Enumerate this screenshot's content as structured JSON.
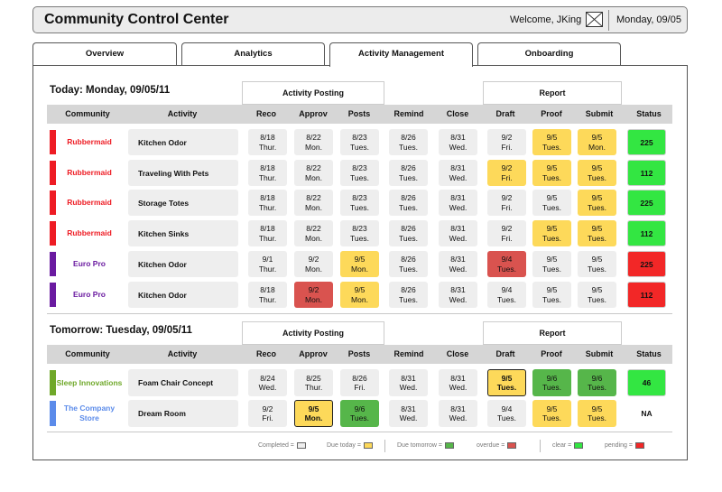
{
  "header": {
    "title": "Community Control Center",
    "welcome": "Welcome, JKing",
    "date": "Monday, 09/05"
  },
  "tabs": [
    "Overview",
    "Analytics",
    "Activity Management",
    "Onboarding"
  ],
  "active_tab": "Activity Management",
  "colors": {
    "completed": "#eeeeee",
    "due_today": "#fdd95a",
    "due_tomorrow": "#56b64a",
    "overdue": "#d9534f",
    "clear": "#33e642",
    "pending": "#f22727",
    "rubbermaid": "#ee1c24",
    "europro": "#6a1aa0",
    "sleep_innovations": "#6fa829",
    "company_store": "#5b8bea"
  },
  "group_labels": {
    "posting": "Activity Posting",
    "report": "Report"
  },
  "columns": [
    "Community",
    "Activity",
    "Reco",
    "Approv",
    "Posts",
    "Remind",
    "Close",
    "Draft",
    "Proof",
    "Submit",
    "Status"
  ],
  "sections": [
    {
      "title": "Today: Monday, 09/05/11",
      "rows": [
        {
          "community": "Rubbermaid",
          "community_color": "#ee1c24",
          "activity": "Kitchen Odor",
          "cells": [
            [
              "8/18",
              "Thur.",
              "c"
            ],
            [
              "8/22",
              "Mon.",
              "c"
            ],
            [
              "8/23",
              "Tues.",
              "c"
            ],
            [
              "8/26",
              "Tues.",
              "c"
            ],
            [
              "8/31",
              "Wed.",
              "c"
            ],
            [
              "9/2",
              "Fri.",
              "c"
            ],
            [
              "9/5",
              "Tues.",
              "y"
            ],
            [
              "9/5",
              "Mon.",
              "y"
            ]
          ],
          "status": "225",
          "status_color": "g"
        },
        {
          "community": "Rubbermaid",
          "community_color": "#ee1c24",
          "activity": "Traveling With Pets",
          "cells": [
            [
              "8/18",
              "Thur.",
              "c"
            ],
            [
              "8/22",
              "Mon.",
              "c"
            ],
            [
              "8/23",
              "Tues.",
              "c"
            ],
            [
              "8/26",
              "Tues.",
              "c"
            ],
            [
              "8/31",
              "Wed.",
              "c"
            ],
            [
              "9/2",
              "Fri.",
              "y"
            ],
            [
              "9/5",
              "Tues.",
              "y"
            ],
            [
              "9/5",
              "Tues.",
              "y"
            ]
          ],
          "status": "112",
          "status_color": "g"
        },
        {
          "community": "Rubbermaid",
          "community_color": "#ee1c24",
          "activity": "Storage Totes",
          "cells": [
            [
              "8/18",
              "Thur.",
              "c"
            ],
            [
              "8/22",
              "Mon.",
              "c"
            ],
            [
              "8/23",
              "Tues.",
              "c"
            ],
            [
              "8/26",
              "Tues.",
              "c"
            ],
            [
              "8/31",
              "Wed.",
              "c"
            ],
            [
              "9/2",
              "Fri.",
              "c"
            ],
            [
              "9/5",
              "Tues.",
              "c"
            ],
            [
              "9/5",
              "Tues.",
              "y"
            ]
          ],
          "status": "225",
          "status_color": "g"
        },
        {
          "community": "Rubbermaid",
          "community_color": "#ee1c24",
          "activity": "Kitchen Sinks",
          "cells": [
            [
              "8/18",
              "Thur.",
              "c"
            ],
            [
              "8/22",
              "Mon.",
              "c"
            ],
            [
              "8/23",
              "Tues.",
              "c"
            ],
            [
              "8/26",
              "Tues.",
              "c"
            ],
            [
              "8/31",
              "Wed.",
              "c"
            ],
            [
              "9/2",
              "Fri.",
              "c"
            ],
            [
              "9/5",
              "Tues.",
              "y"
            ],
            [
              "9/5",
              "Tues.",
              "y"
            ]
          ],
          "status": "112",
          "status_color": "g"
        },
        {
          "community": "Euro Pro",
          "community_color": "#6a1aa0",
          "activity": "Kitchen Odor",
          "cells": [
            [
              "9/1",
              "Thur.",
              "c"
            ],
            [
              "9/2",
              "Mon.",
              "c"
            ],
            [
              "9/5",
              "Mon.",
              "y"
            ],
            [
              "8/26",
              "Tues.",
              "c"
            ],
            [
              "8/31",
              "Wed.",
              "c"
            ],
            [
              "9/4",
              "Tues.",
              "r"
            ],
            [
              "9/5",
              "Tues.",
              "c"
            ],
            [
              "9/5",
              "Tues.",
              "c"
            ]
          ],
          "status": "225",
          "status_color": "r"
        },
        {
          "community": "Euro Pro",
          "community_color": "#6a1aa0",
          "activity": "Kitchen Odor",
          "cells": [
            [
              "8/18",
              "Thur.",
              "c"
            ],
            [
              "9/2",
              "Mon.",
              "r"
            ],
            [
              "9/5",
              "Mon.",
              "y"
            ],
            [
              "8/26",
              "Tues.",
              "c"
            ],
            [
              "8/31",
              "Wed.",
              "c"
            ],
            [
              "9/4",
              "Tues.",
              "c"
            ],
            [
              "9/5",
              "Tues.",
              "c"
            ],
            [
              "9/5",
              "Tues.",
              "c"
            ]
          ],
          "status": "112",
          "status_color": "r"
        }
      ]
    },
    {
      "title": "Tomorrow: Tuesday, 09/05/11",
      "rows": [
        {
          "community": "Sleep Innovations",
          "community_color": "#6fa829",
          "activity": "Foam Chair Concept",
          "cells": [
            [
              "8/24",
              "Wed.",
              "c"
            ],
            [
              "8/25",
              "Thur.",
              "c"
            ],
            [
              "8/26",
              "Fri.",
              "c"
            ],
            [
              "8/31",
              "Wed.",
              "c"
            ],
            [
              "8/31",
              "Wed.",
              "c"
            ],
            [
              "9/5",
              "Tues.",
              "yb"
            ],
            [
              "9/6",
              "Tues.",
              "gd"
            ],
            [
              "9/6",
              "Tues.",
              "gd"
            ]
          ],
          "status": "46",
          "status_color": "g"
        },
        {
          "community": "The Company Store",
          "community_color": "#5b8bea",
          "activity": "Dream Room",
          "cells": [
            [
              "9/2",
              "Fri.",
              "c"
            ],
            [
              "9/5",
              "Mon.",
              "yb"
            ],
            [
              "9/6",
              "Tues.",
              "gd"
            ],
            [
              "8/31",
              "Wed.",
              "c"
            ],
            [
              "8/31",
              "Wed.",
              "c"
            ],
            [
              "9/4",
              "Tues.",
              "c"
            ],
            [
              "9/5",
              "Tues.",
              "y"
            ],
            [
              "9/5",
              "Tues.",
              "y"
            ]
          ],
          "status": "NA",
          "status_color": "n"
        }
      ]
    }
  ],
  "legend": [
    {
      "label": "Completed =",
      "color": "#eeeeee"
    },
    {
      "label": "Due today =",
      "color": "#fdd95a"
    },
    {
      "label": "Due tomorrow =",
      "color": "#56b64a"
    },
    {
      "label": "overdue =",
      "color": "#d9534f"
    },
    {
      "label": "clear =",
      "color": "#33e642"
    },
    {
      "label": "pending =",
      "color": "#f22727"
    }
  ]
}
